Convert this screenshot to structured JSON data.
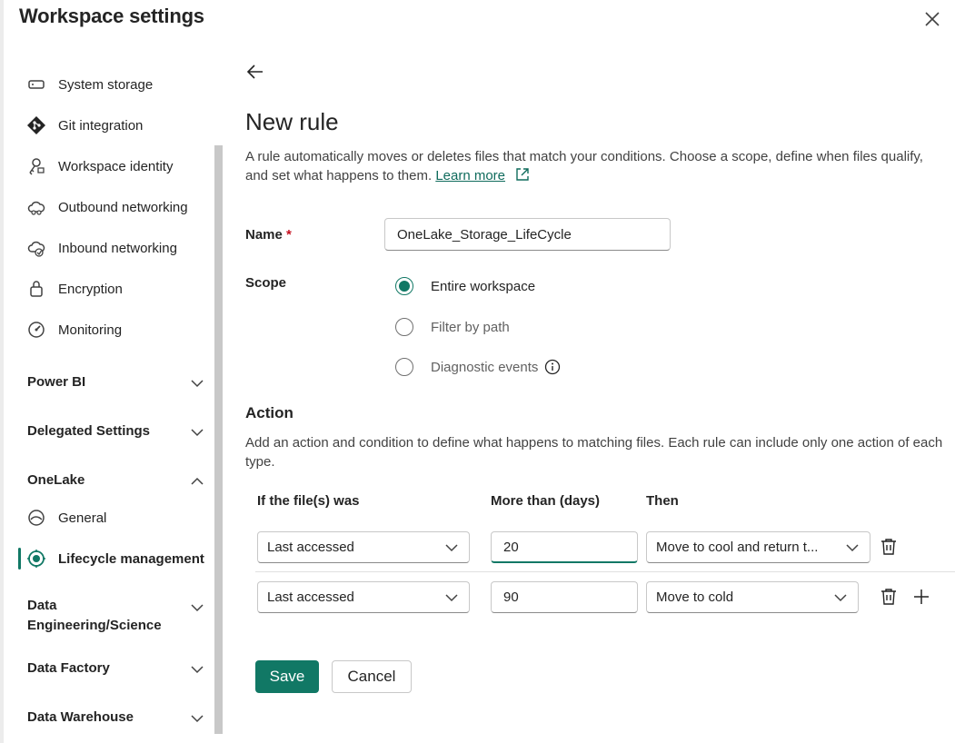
{
  "dialog": {
    "title": "Workspace settings"
  },
  "sidebar": {
    "items": [
      {
        "label": "System storage",
        "icon": "storage-icon"
      },
      {
        "label": "Git integration",
        "icon": "git-icon"
      },
      {
        "label": "Workspace identity",
        "icon": "identity-key-icon"
      },
      {
        "label": "Outbound networking",
        "icon": "cloud-outbound-icon"
      },
      {
        "label": "Inbound networking",
        "icon": "cloud-inbound-icon"
      },
      {
        "label": "Encryption",
        "icon": "lock-icon"
      },
      {
        "label": "Monitoring",
        "icon": "gauge-icon"
      }
    ],
    "groups": {
      "power_bi": "Power BI",
      "delegated": "Delegated Settings",
      "onelake": "OneLake",
      "data_eng_line1": "Data",
      "data_eng_line2": "Engineering/Science",
      "data_factory": "Data Factory",
      "data_warehouse": "Data Warehouse"
    },
    "onelake_items": [
      {
        "label": "General",
        "icon": "onelake-icon"
      },
      {
        "label": "Lifecycle management",
        "icon": "lifecycle-icon",
        "active": true
      }
    ]
  },
  "form": {
    "heading": "New rule",
    "description": "A rule automatically moves or deletes files that match your conditions. Choose a scope, define when files qualify, and set what happens to them.",
    "learn_more": "Learn more",
    "name_label": "Name",
    "required_mark": "*",
    "name_value": "OneLake_Storage_LifeCycle",
    "scope_label": "Scope",
    "scope_options": [
      {
        "label": "Entire workspace",
        "checked": true
      },
      {
        "label": "Filter by path",
        "checked": false
      },
      {
        "label": "Diagnostic events",
        "checked": false
      }
    ]
  },
  "action": {
    "heading": "Action",
    "description": "Add an action and condition to define what happens to matching files. Each rule can include only one action of each type.",
    "columns": [
      "If the file(s) was",
      "More than (days)",
      "Then"
    ],
    "rows": [
      {
        "condition": "Last accessed",
        "days": "20",
        "then": "Move to cool and return t..."
      },
      {
        "condition": "Last accessed",
        "days": "90",
        "then": "Move to cold"
      }
    ]
  },
  "buttons": {
    "save": "Save",
    "cancel": "Cancel"
  },
  "colors": {
    "accent": "#117865",
    "link": "#0f6b5c",
    "required": "#c50f1f"
  }
}
